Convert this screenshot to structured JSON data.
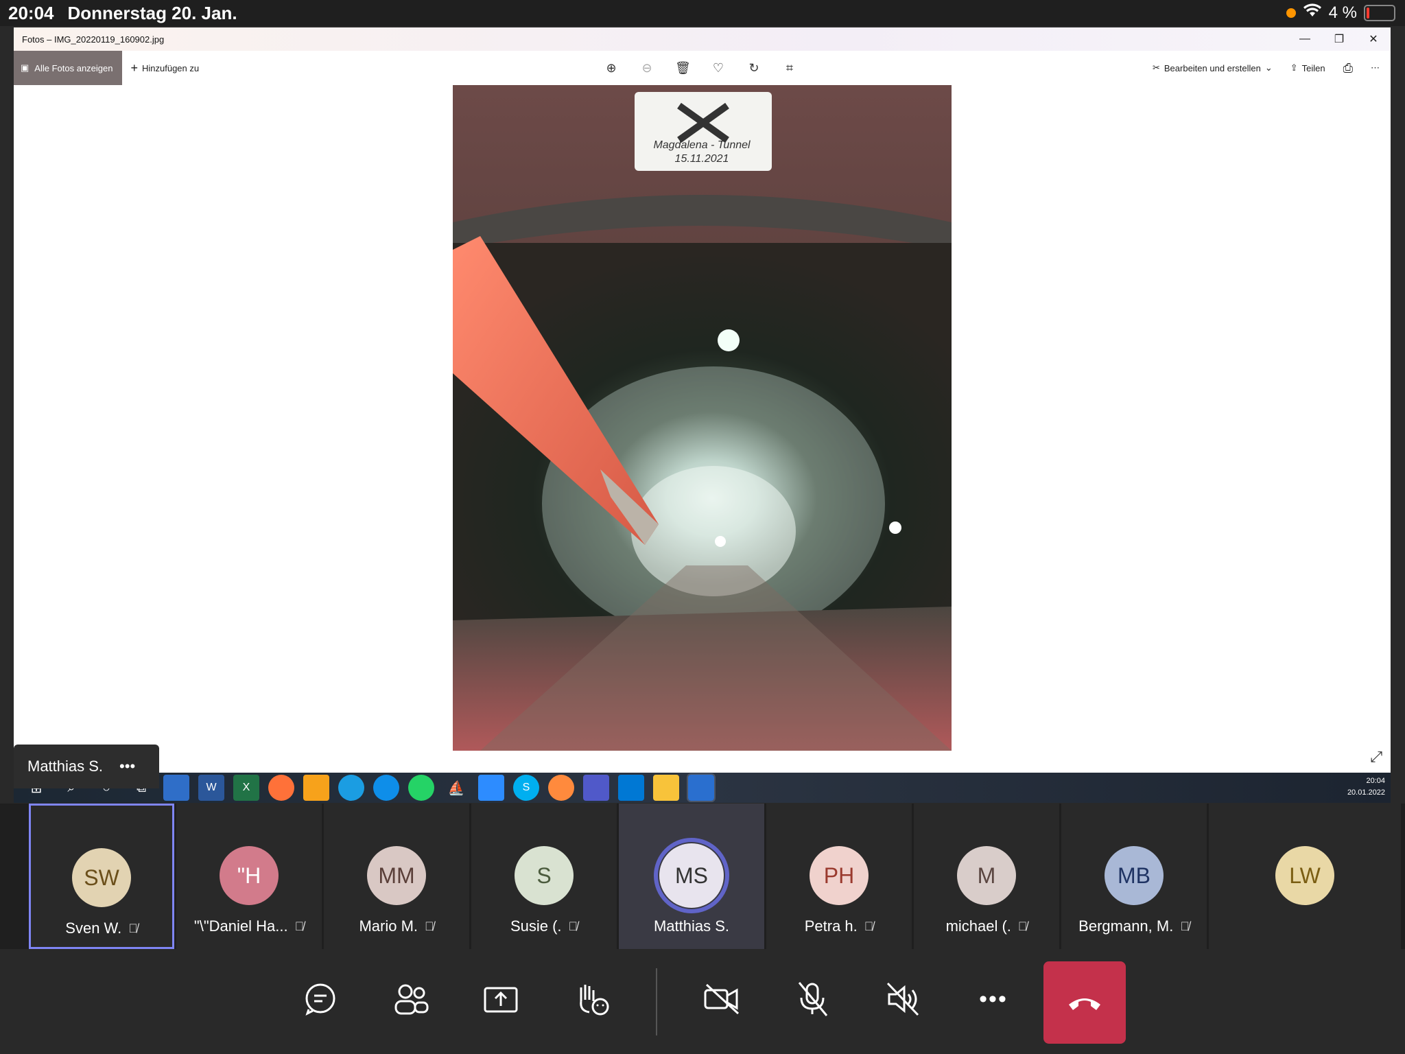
{
  "status_bar": {
    "time": "20:04",
    "date": "Donnerstag 20. Jan.",
    "battery": "4 %"
  },
  "photos_app": {
    "title": "Fotos – IMG_20220119_160902.jpg",
    "all_photos_label": "Alle Fotos anzeigen",
    "add_to_label": "Hinzufügen zu",
    "edit_label": "Bearbeiten und erstellen",
    "share_label": "Teilen",
    "photo_sign_line1": "Magdalena - Tunnel",
    "photo_sign_line2": "15.11.2021"
  },
  "taskbar": {
    "time": "20:04",
    "date": "20.01.2022"
  },
  "presenter_tag": {
    "name": "Matthias S.",
    "more": "•••"
  },
  "participants": [
    {
      "initials": "SW",
      "name": "Sven W.",
      "bg": "#e2d3b2",
      "fg": "#6b4f1a",
      "muted": true
    },
    {
      "initials": "\"H",
      "name": "\"\\\"Daniel Ha...",
      "bg": "#d27b8b",
      "fg": "#ffffff",
      "muted": true
    },
    {
      "initials": "MM",
      "name": "Mario M.",
      "bg": "#d9c8c4",
      "fg": "#5a3f39",
      "muted": true
    },
    {
      "initials": "S",
      "name": "Susie (.",
      "bg": "#d9e2d1",
      "fg": "#4b5b3d",
      "muted": true
    },
    {
      "initials": "MS",
      "name": "Matthias S.",
      "bg": "#e8e4ee",
      "fg": "#333333",
      "muted": false
    },
    {
      "initials": "PH",
      "name": "Petra h.",
      "bg": "#f0d2cd",
      "fg": "#9a3a2e",
      "muted": true
    },
    {
      "initials": "M",
      "name": "michael (.",
      "bg": "#d9cdca",
      "fg": "#5a4540",
      "muted": true
    },
    {
      "initials": "MB",
      "name": "Bergmann, M.",
      "bg": "#a9b8d6",
      "fg": "#1f3363",
      "muted": true
    },
    {
      "initials": "LW",
      "name": "",
      "bg": "#e9d8a6",
      "fg": "#7a5d12",
      "muted": false
    }
  ],
  "controls": {
    "more": "•••"
  }
}
